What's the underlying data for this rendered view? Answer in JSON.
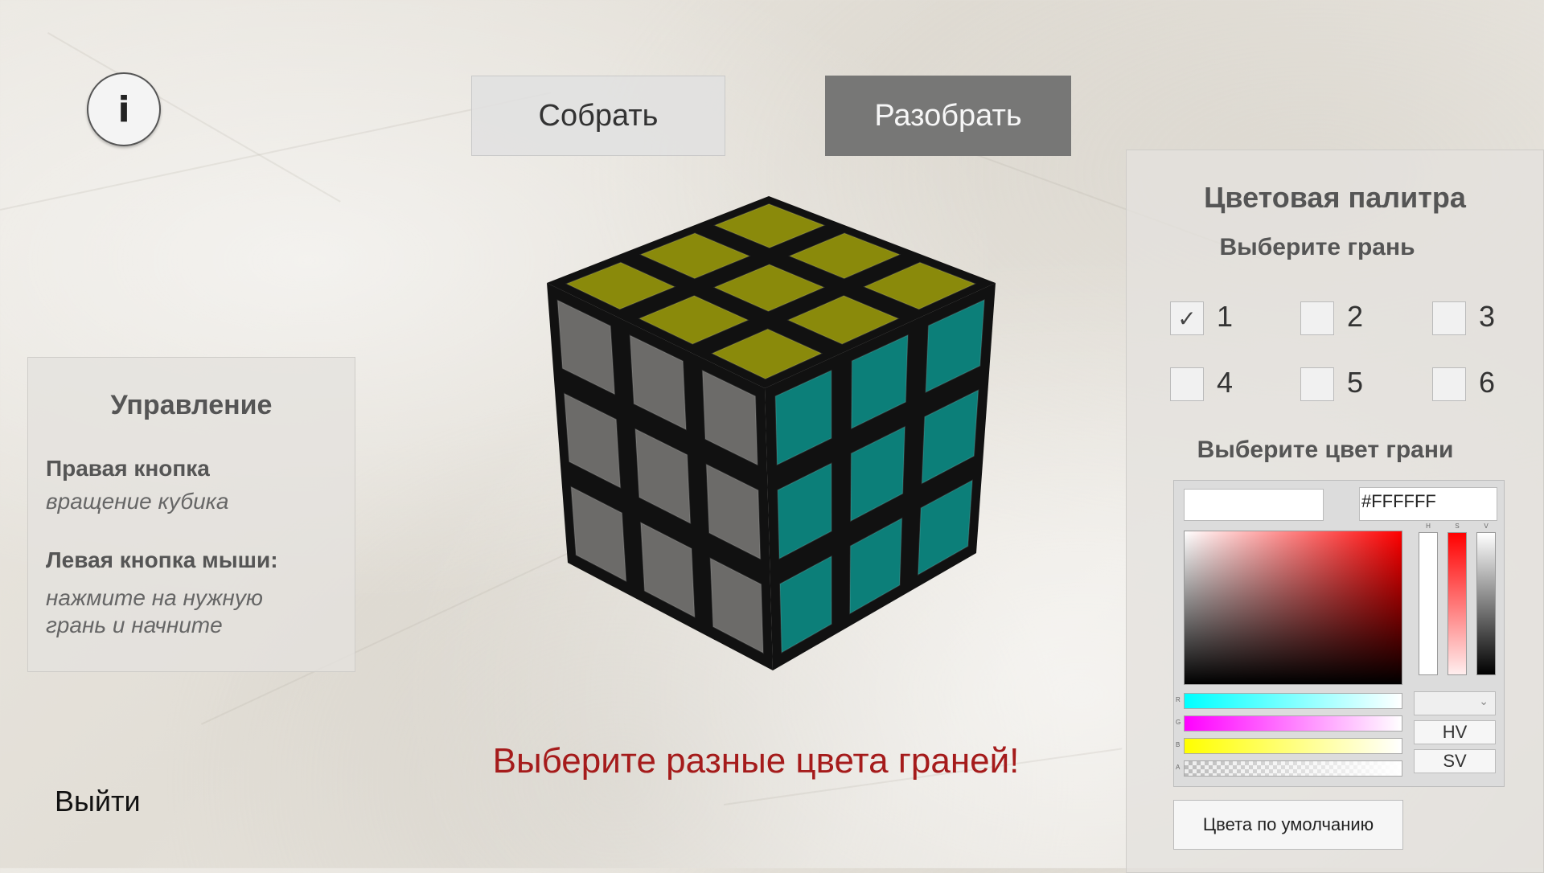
{
  "info_button": {
    "label": "i"
  },
  "top_buttons": {
    "assemble": "Собрать",
    "scramble": "Разобрать"
  },
  "controls": {
    "title": "Управление",
    "right_button_label": "Правая кнопка",
    "right_button_desc": "вращение кубика",
    "left_button_label": "Левая кнопка мыши:",
    "left_button_desc_1": "нажмите на нужную",
    "left_button_desc_2": "грань и начните"
  },
  "palette": {
    "title": "Цветовая палитра",
    "choose_face": "Выберите грань",
    "faces": [
      {
        "label": "1",
        "checked": true
      },
      {
        "label": "2",
        "checked": false
      },
      {
        "label": "3",
        "checked": false
      },
      {
        "label": "4",
        "checked": false
      },
      {
        "label": "5",
        "checked": false
      },
      {
        "label": "6",
        "checked": false
      }
    ],
    "choose_color": "Выберите цвет грани",
    "hex_value": "#FFFFFF",
    "current_color": "#FFFFFF",
    "mode_buttons": [
      "HV",
      "SV"
    ],
    "slider_captions": [
      "R",
      "G",
      "B",
      "A"
    ],
    "bar_captions": [
      "H",
      "S",
      "V"
    ],
    "default_colors_button": "Цвета по умолчанию"
  },
  "cube": {
    "top_color": "#8a8a0b",
    "left_color": "#6c6b69",
    "right_color": "#0c7f79"
  },
  "warning": "Выберите разные цвета граней!",
  "exit_button": "Выйти"
}
